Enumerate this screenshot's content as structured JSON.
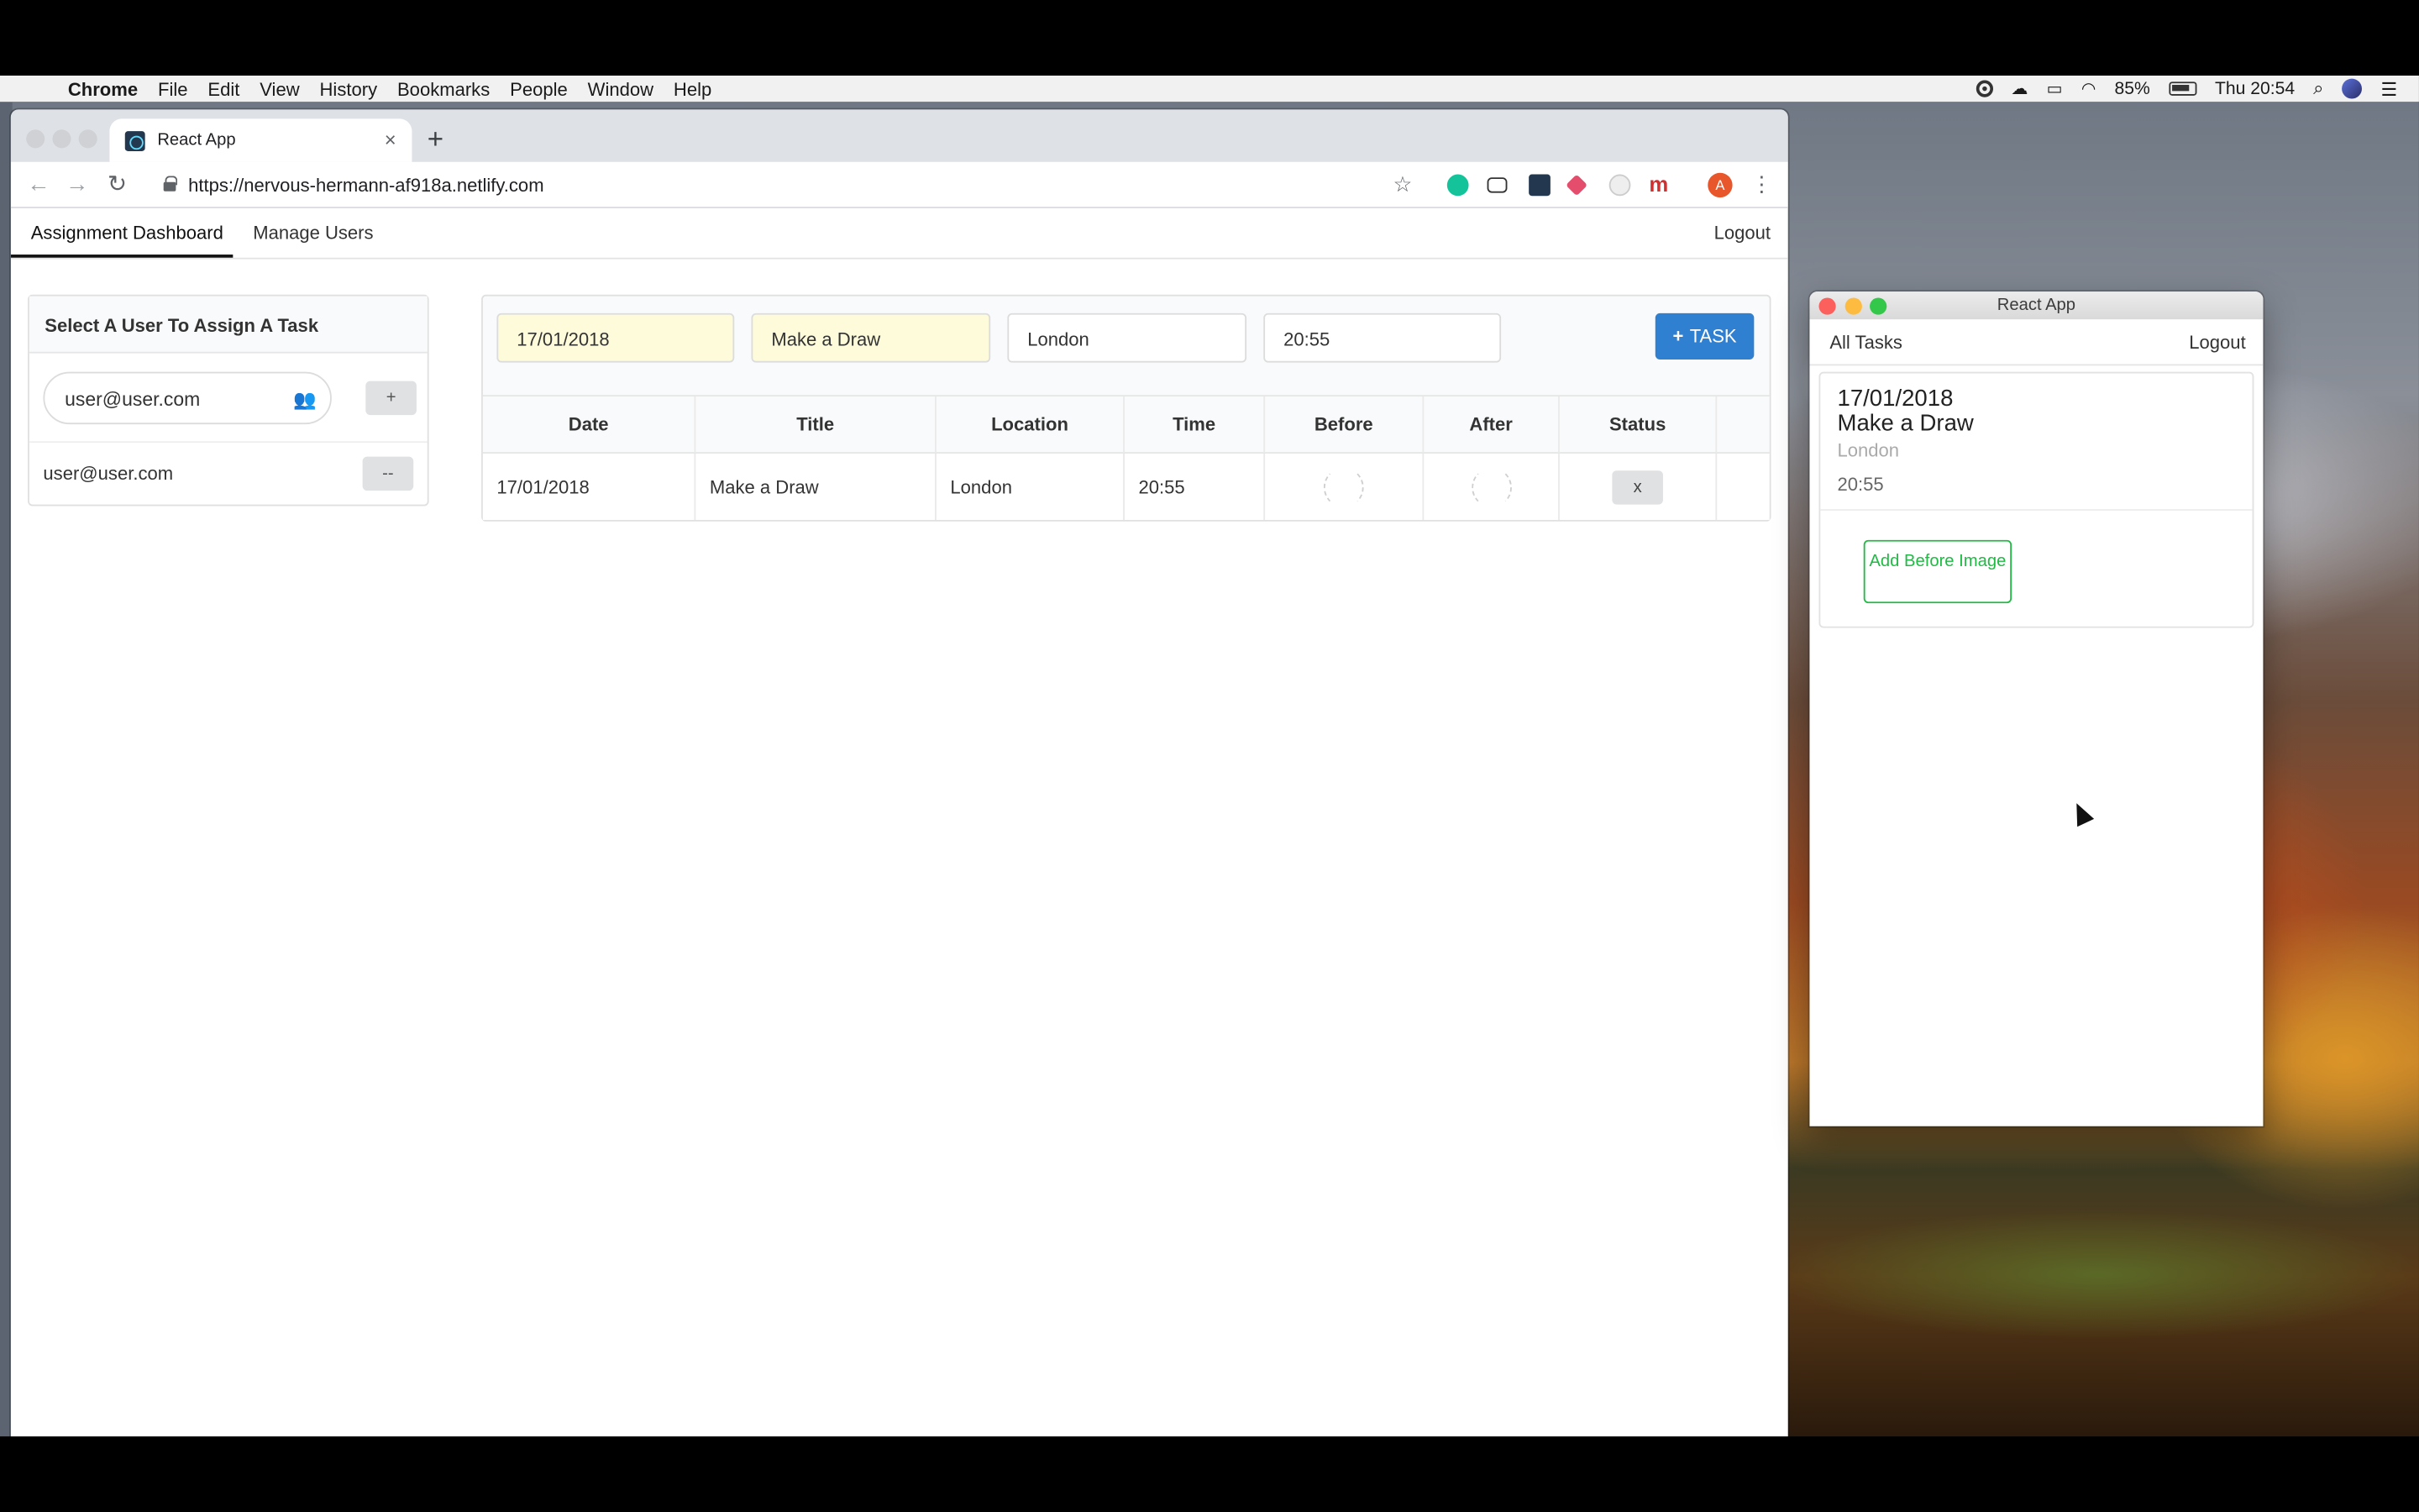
{
  "menubar": {
    "app": "Chrome",
    "items": [
      "File",
      "Edit",
      "View",
      "History",
      "Bookmarks",
      "People",
      "Window",
      "Help"
    ],
    "battery": "85%",
    "clock": "Thu 20:54"
  },
  "browser": {
    "tab_title": "React App",
    "url": "https://nervous-hermann-af918a.netlify.com",
    "profile_initial": "A"
  },
  "app": {
    "nav": {
      "dashboard": "Assignment Dashboard",
      "manage_users": "Manage Users",
      "logout": "Logout"
    },
    "user_panel": {
      "heading": "Select A User To Assign A Task",
      "input_value": "user@user.com",
      "add_label": "+",
      "assigned_user": "user@user.com",
      "remove_label": "--"
    },
    "task_form": {
      "date": "17/01/2018",
      "title": "Make a Draw",
      "location": "London",
      "time": "20:55",
      "add_button": "TASK"
    },
    "table": {
      "headers": [
        "Date",
        "Title",
        "Location",
        "Time",
        "Before",
        "After",
        "Status"
      ],
      "rows": [
        {
          "date": "17/01/2018",
          "title": "Make a Draw",
          "location": "London",
          "time": "20:55",
          "status_button": "x"
        }
      ]
    }
  },
  "second_window": {
    "title": "React App",
    "nav": {
      "all_tasks": "All Tasks",
      "logout": "Logout"
    },
    "card": {
      "date": "17/01/2018",
      "title": "Make a Draw",
      "location": "London",
      "time": "20:55",
      "button": "Add Before Image"
    }
  },
  "colors": {
    "primary_blue": "#2f80d1",
    "green": "#21ba45",
    "highlight": "#fefbdb"
  }
}
